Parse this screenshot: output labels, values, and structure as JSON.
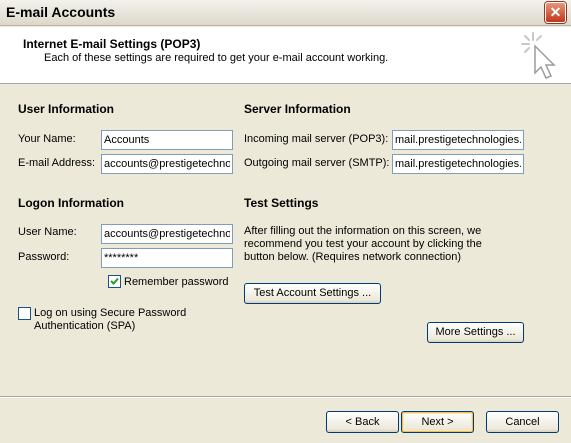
{
  "window": {
    "title": "E-mail Accounts"
  },
  "header": {
    "title": "Internet E-mail Settings (POP3)",
    "subtitle": "Each of these settings are required to get your e-mail account working."
  },
  "user_info": {
    "heading": "User Information",
    "name_label": "Your Name:",
    "name_value": "Accounts",
    "email_label": "E-mail Address:",
    "email_value": "accounts@prestigetechnol"
  },
  "logon_info": {
    "heading": "Logon Information",
    "username_label": "User Name:",
    "username_value": "accounts@prestigetechnol",
    "password_label": "Password:",
    "password_value": "********",
    "remember_label": "Remember password",
    "remember_checked": true,
    "spa_label_line1": "Log on using Secure Password",
    "spa_label_line2": "Authentication (SPA)",
    "spa_checked": false
  },
  "server_info": {
    "heading": "Server Information",
    "incoming_label": "Incoming mail server (POP3):",
    "incoming_value": "mail.prestigetechnologies.c",
    "outgoing_label": "Outgoing mail server (SMTP):",
    "outgoing_value": "mail.prestigetechnologies.c"
  },
  "test_settings": {
    "heading": "Test Settings",
    "description_line1": "After filling out the information on this screen, we",
    "description_line2": "recommend you test your account by clicking the",
    "description_line3": "button below. (Requires network connection)",
    "test_button": "Test Account Settings ..."
  },
  "more_settings_button": "More Settings ...",
  "footer": {
    "back": "< Back",
    "next": "Next >",
    "cancel": "Cancel"
  },
  "icons": {
    "close": "close-icon",
    "header": "cursor-sparkle-icon",
    "check": "checkmark-icon"
  }
}
